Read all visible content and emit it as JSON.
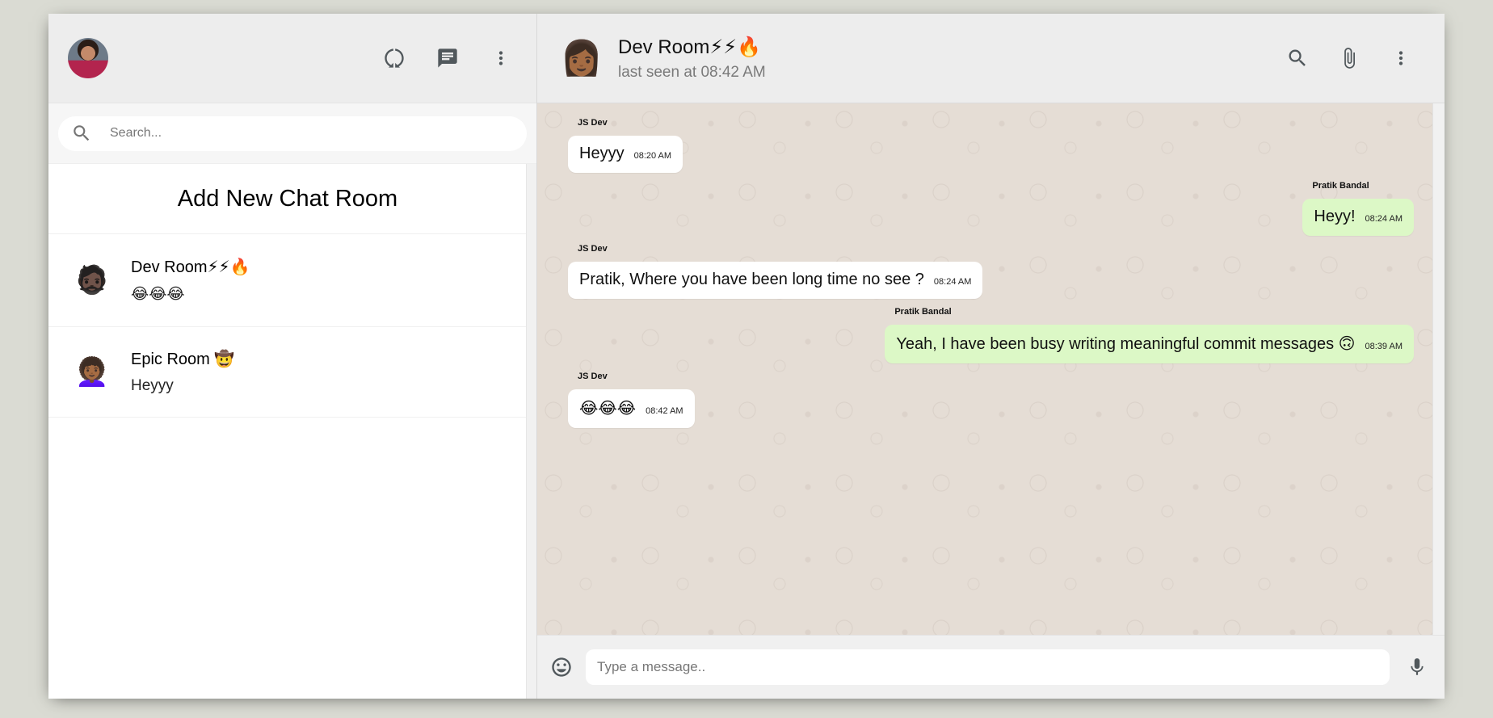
{
  "sidebar": {
    "search_placeholder": "Search...",
    "add_room_label": "Add New Chat Room",
    "chats": [
      {
        "name": "Dev Room⚡⚡🔥",
        "last_message": "😂😂😂",
        "avatar_emoji": "🧔🏿"
      },
      {
        "name": "Epic Room 🤠",
        "last_message": "Heyyy",
        "avatar_emoji": "👩🏾‍🦱"
      }
    ]
  },
  "chat": {
    "room_name": "Dev Room⚡⚡🔥",
    "last_seen": "last seen at 08:42 AM",
    "avatar_emoji": "👩🏾",
    "messages": [
      {
        "sender": "JS Dev",
        "text": "Heyyy",
        "time": "08:20 AM",
        "mine": false
      },
      {
        "sender": "Pratik Bandal",
        "text": "Heyy!",
        "time": "08:24 AM",
        "mine": true
      },
      {
        "sender": "JS Dev",
        "text": "Pratik, Where you have been long time no see ?",
        "time": "08:24 AM",
        "mine": false
      },
      {
        "sender": "Pratik Bandal",
        "text": "Yeah, I have been busy writing meaningful commit messages 🙃",
        "time": "08:39 AM",
        "mine": true
      },
      {
        "sender": "JS Dev",
        "text": "😂😂😂",
        "time": "08:42 AM",
        "mine": false
      }
    ],
    "input_placeholder": "Type a message.."
  },
  "icons": {
    "status": "status-icon",
    "new_chat": "chat-icon",
    "menu": "more-vert-icon",
    "search": "search-icon",
    "attach": "attach-icon",
    "emoji": "emoji-icon",
    "mic": "mic-icon"
  },
  "colors": {
    "outgoing_bubble": "#dcf8c6",
    "incoming_bubble": "#ffffff",
    "chat_background": "#e5ddd5",
    "header_background": "#ededed"
  }
}
